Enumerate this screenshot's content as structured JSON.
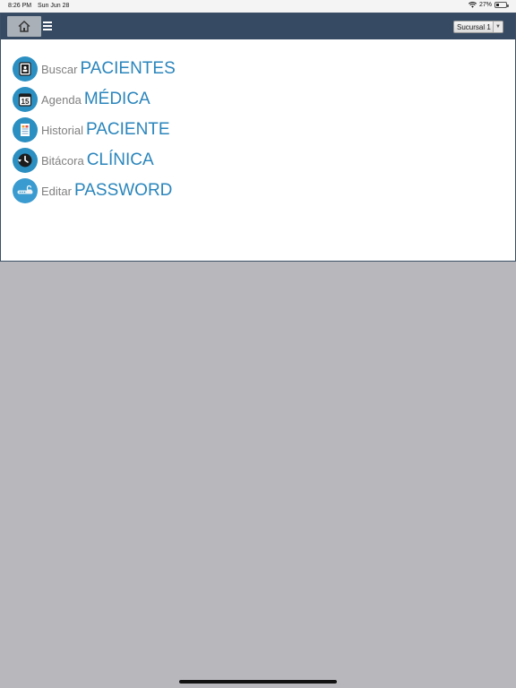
{
  "status_bar": {
    "time": "8:26 PM",
    "date": "Sun Jun 28",
    "battery": "27%",
    "battery_level": 0.27
  },
  "navbar": {
    "branch_select": {
      "selected": "Sucursal 1"
    }
  },
  "menu": [
    {
      "small": "Buscar",
      "big": "PACIENTES",
      "icon": "patient-card-icon"
    },
    {
      "small": "Agenda",
      "big": "MÉDICA",
      "icon": "calendar-icon"
    },
    {
      "small": "Historial",
      "big": "PACIENTE",
      "icon": "document-icon"
    },
    {
      "small": "Bitácora",
      "big": "CLÍNICA",
      "icon": "history-clock-icon"
    },
    {
      "small": "Editar",
      "big": "PASSWORD",
      "icon": "lock-icon"
    }
  ],
  "colors": {
    "navbar": "#364b63",
    "accent": "#2a85bc",
    "label": "#808080",
    "background": "#b8b8bc"
  }
}
